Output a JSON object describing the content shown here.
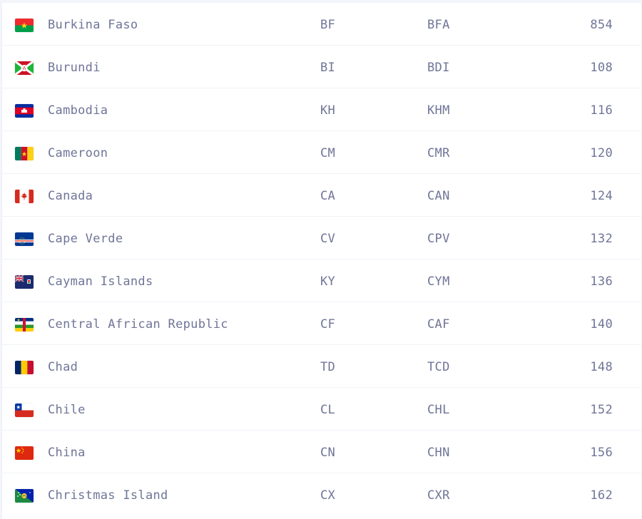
{
  "countries": [
    {
      "name": "Burkina Faso",
      "alpha2": "BF",
      "alpha3": "BFA",
      "numeric": "854",
      "flag_icon": "burkina-faso-flag-icon"
    },
    {
      "name": "Burundi",
      "alpha2": "BI",
      "alpha3": "BDI",
      "numeric": "108",
      "flag_icon": "burundi-flag-icon"
    },
    {
      "name": "Cambodia",
      "alpha2": "KH",
      "alpha3": "KHM",
      "numeric": "116",
      "flag_icon": "cambodia-flag-icon"
    },
    {
      "name": "Cameroon",
      "alpha2": "CM",
      "alpha3": "CMR",
      "numeric": "120",
      "flag_icon": "cameroon-flag-icon"
    },
    {
      "name": "Canada",
      "alpha2": "CA",
      "alpha3": "CAN",
      "numeric": "124",
      "flag_icon": "canada-flag-icon"
    },
    {
      "name": "Cape Verde",
      "alpha2": "CV",
      "alpha3": "CPV",
      "numeric": "132",
      "flag_icon": "cape-verde-flag-icon"
    },
    {
      "name": "Cayman Islands",
      "alpha2": "KY",
      "alpha3": "CYM",
      "numeric": "136",
      "flag_icon": "cayman-islands-flag-icon"
    },
    {
      "name": "Central African Republic",
      "alpha2": "CF",
      "alpha3": "CAF",
      "numeric": "140",
      "flag_icon": "central-african-republic-flag-icon"
    },
    {
      "name": "Chad",
      "alpha2": "TD",
      "alpha3": "TCD",
      "numeric": "148",
      "flag_icon": "chad-flag-icon"
    },
    {
      "name": "Chile",
      "alpha2": "CL",
      "alpha3": "CHL",
      "numeric": "152",
      "flag_icon": "chile-flag-icon"
    },
    {
      "name": "China",
      "alpha2": "CN",
      "alpha3": "CHN",
      "numeric": "156",
      "flag_icon": "china-flag-icon"
    },
    {
      "name": "Christmas Island",
      "alpha2": "CX",
      "alpha3": "CXR",
      "numeric": "162",
      "flag_icon": "christmas-island-flag-icon"
    }
  ],
  "colors": {
    "text": "#6f7597",
    "row_border": "#f0f2f8",
    "background": "#ffffff"
  }
}
